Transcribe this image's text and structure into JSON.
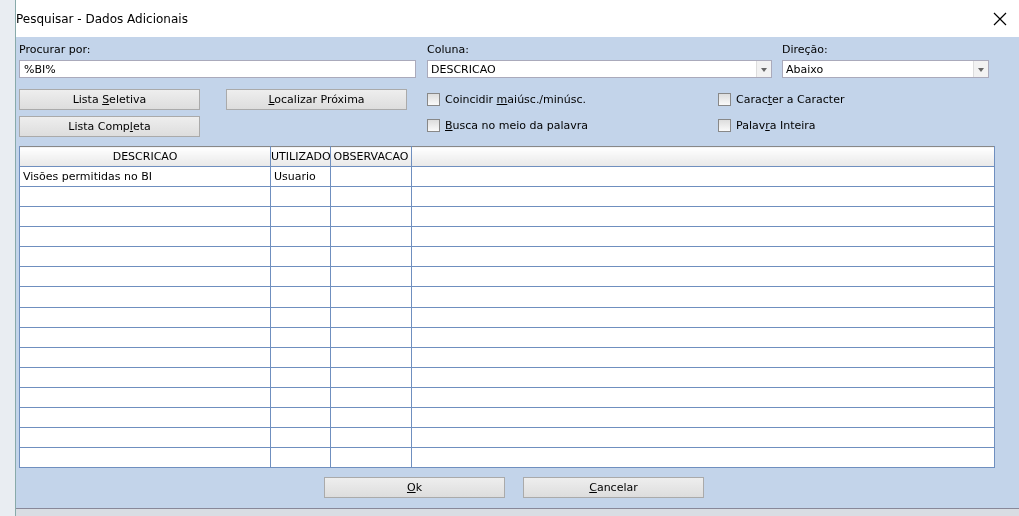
{
  "window": {
    "title": "Pesquisar - Dados Adicionais"
  },
  "search": {
    "label": "Procurar por:",
    "value": "%BI%"
  },
  "column": {
    "label": "Coluna:",
    "value": "DESCRICAO"
  },
  "direction": {
    "label": "Direção:",
    "value": "Abaixo"
  },
  "left_buttons": [
    {
      "before": "Lista ",
      "key": "S",
      "after": "eletiva"
    },
    {
      "before": "Lista Comp",
      "key": "l",
      "after": "eta"
    }
  ],
  "find_next": {
    "key": "L",
    "after": "ocalizar Próxima"
  },
  "options": [
    {
      "before": "Coincidir ",
      "key": "m",
      "after": "aiúsc./minúsc.",
      "checked": false
    },
    {
      "key": "B",
      "after": "usca no meio da palavra",
      "checked": false
    },
    {
      "before": "Carac",
      "key": "t",
      "after": "er a Caracter",
      "checked": false
    },
    {
      "before": "Palav",
      "key": "r",
      "after": "a Inteira",
      "checked": false
    }
  ],
  "table": {
    "columns": [
      "DESCRICAO",
      "UTILIZADO",
      "OBSERVACAO"
    ],
    "rows": [
      [
        "Visões permitidas no BI",
        "Usuario",
        null
      ]
    ]
  },
  "buttons": [
    {
      "key": "O",
      "after": "k"
    },
    {
      "key": "C",
      "after": "ancelar"
    }
  ]
}
